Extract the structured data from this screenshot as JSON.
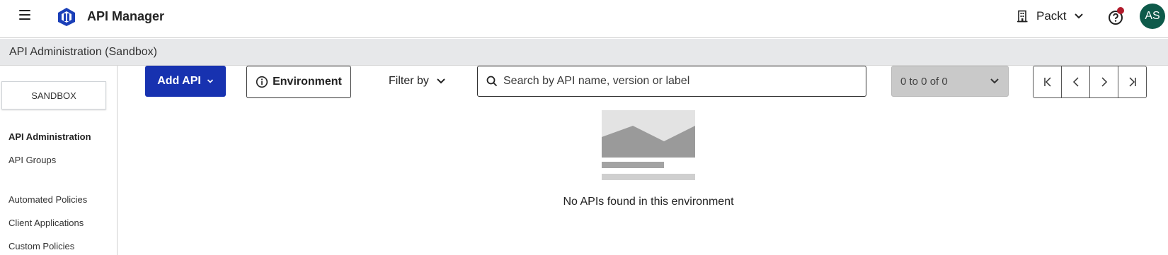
{
  "header": {
    "menu_icon": "hamburger-icon",
    "logo_icon": "api-manager-logo-icon",
    "app_title": "API Manager",
    "org_name": "Packt",
    "help_icon": "help-icon",
    "avatar_initials": "AS",
    "colors": {
      "avatar": "#0e5a4a",
      "notification_dot": "#b11a2b"
    }
  },
  "subheader": {
    "title": "API Administration (Sandbox)"
  },
  "sidebar": {
    "environment_button": "SANDBOX",
    "items": [
      {
        "label": "API Administration",
        "active": true
      },
      {
        "label": "API Groups",
        "active": false
      },
      {
        "label": "Automated Policies",
        "active": false
      },
      {
        "label": "Client Applications",
        "active": false
      },
      {
        "label": "Custom Policies",
        "active": false
      }
    ]
  },
  "toolbar": {
    "add_api_label": "Add API",
    "environment_label": "Environment",
    "filter_label": "Filter by",
    "search_placeholder": "Search by API name, version or label",
    "pagination_range": "0 to 0 of 0",
    "colors": {
      "primary": "#1732b0",
      "pager_bg": "#c9c9c9"
    }
  },
  "empty_state": {
    "message": "No APIs found in this environment"
  }
}
